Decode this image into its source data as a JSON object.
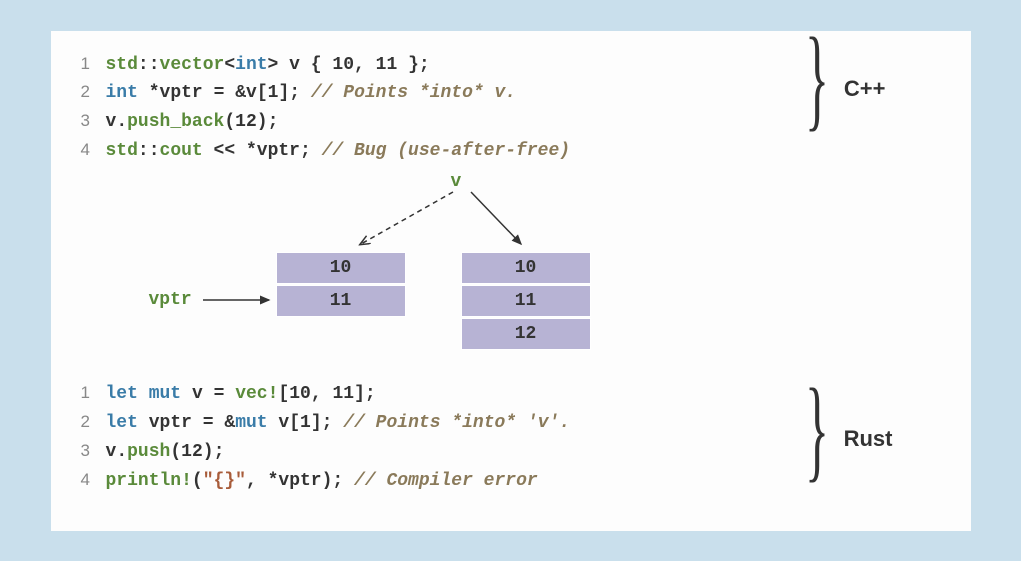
{
  "cpp": {
    "lines": [
      {
        "num": "1",
        "tokens": [
          {
            "cls": "tk-ns",
            "t": "std"
          },
          {
            "cls": "tk-op",
            "t": "::"
          },
          {
            "cls": "tk-ns",
            "t": "vector"
          },
          {
            "cls": "tk-op",
            "t": "<"
          },
          {
            "cls": "tk-type",
            "t": "int"
          },
          {
            "cls": "tk-op",
            "t": ">"
          },
          {
            "cls": "",
            "t": " "
          },
          {
            "cls": "tk-var",
            "t": "v"
          },
          {
            "cls": "",
            "t": " "
          },
          {
            "cls": "tk-op",
            "t": "{"
          },
          {
            "cls": "",
            "t": " "
          },
          {
            "cls": "tk-num",
            "t": "10"
          },
          {
            "cls": "tk-op",
            "t": ","
          },
          {
            "cls": "",
            "t": " "
          },
          {
            "cls": "tk-num",
            "t": "11"
          },
          {
            "cls": "",
            "t": " "
          },
          {
            "cls": "tk-op",
            "t": "}"
          },
          {
            "cls": "tk-op",
            "t": ";"
          }
        ]
      },
      {
        "num": "2",
        "tokens": [
          {
            "cls": "tk-type",
            "t": "int"
          },
          {
            "cls": "",
            "t": " "
          },
          {
            "cls": "tk-op",
            "t": "*"
          },
          {
            "cls": "tk-var",
            "t": "vptr"
          },
          {
            "cls": "",
            "t": " "
          },
          {
            "cls": "tk-op",
            "t": "="
          },
          {
            "cls": "",
            "t": " "
          },
          {
            "cls": "tk-op",
            "t": "&"
          },
          {
            "cls": "tk-var",
            "t": "v"
          },
          {
            "cls": "tk-op",
            "t": "["
          },
          {
            "cls": "tk-num",
            "t": "1"
          },
          {
            "cls": "tk-op",
            "t": "]"
          },
          {
            "cls": "tk-op",
            "t": ";"
          },
          {
            "cls": "",
            "t": " "
          },
          {
            "cls": "tk-comment",
            "t": "// Points *into* v."
          }
        ]
      },
      {
        "num": "3",
        "tokens": [
          {
            "cls": "tk-var",
            "t": "v"
          },
          {
            "cls": "tk-op",
            "t": "."
          },
          {
            "cls": "tk-fn",
            "t": "push_back"
          },
          {
            "cls": "tk-op",
            "t": "("
          },
          {
            "cls": "tk-num",
            "t": "12"
          },
          {
            "cls": "tk-op",
            "t": ")"
          },
          {
            "cls": "tk-op",
            "t": ";"
          }
        ]
      },
      {
        "num": "4",
        "tokens": [
          {
            "cls": "tk-ns",
            "t": "std"
          },
          {
            "cls": "tk-op",
            "t": "::"
          },
          {
            "cls": "tk-ns",
            "t": "cout"
          },
          {
            "cls": "",
            "t": " "
          },
          {
            "cls": "tk-op",
            "t": "<<"
          },
          {
            "cls": "",
            "t": " "
          },
          {
            "cls": "tk-op",
            "t": "*"
          },
          {
            "cls": "tk-var",
            "t": "vptr"
          },
          {
            "cls": "tk-op",
            "t": ";"
          },
          {
            "cls": "",
            "t": " "
          },
          {
            "cls": "tk-comment",
            "t": "// Bug (use-after-free)"
          }
        ]
      }
    ],
    "label": "C++"
  },
  "rust": {
    "lines": [
      {
        "num": "1",
        "tokens": [
          {
            "cls": "tk-kw",
            "t": "let mut"
          },
          {
            "cls": "",
            "t": " "
          },
          {
            "cls": "tk-var",
            "t": "v"
          },
          {
            "cls": "",
            "t": " "
          },
          {
            "cls": "tk-op",
            "t": "="
          },
          {
            "cls": "",
            "t": " "
          },
          {
            "cls": "tk-macro",
            "t": "vec!"
          },
          {
            "cls": "tk-op",
            "t": "["
          },
          {
            "cls": "tk-num",
            "t": "10"
          },
          {
            "cls": "tk-op",
            "t": ","
          },
          {
            "cls": "",
            "t": " "
          },
          {
            "cls": "tk-num",
            "t": "11"
          },
          {
            "cls": "tk-op",
            "t": "]"
          },
          {
            "cls": "tk-op",
            "t": ";"
          }
        ]
      },
      {
        "num": "2",
        "tokens": [
          {
            "cls": "tk-kw",
            "t": "let"
          },
          {
            "cls": "",
            "t": " "
          },
          {
            "cls": "tk-var",
            "t": "vptr"
          },
          {
            "cls": "",
            "t": " "
          },
          {
            "cls": "tk-op",
            "t": "="
          },
          {
            "cls": "",
            "t": " "
          },
          {
            "cls": "tk-op",
            "t": "&"
          },
          {
            "cls": "tk-kw",
            "t": "mut"
          },
          {
            "cls": "",
            "t": " "
          },
          {
            "cls": "tk-var",
            "t": "v"
          },
          {
            "cls": "tk-op",
            "t": "["
          },
          {
            "cls": "tk-num",
            "t": "1"
          },
          {
            "cls": "tk-op",
            "t": "]"
          },
          {
            "cls": "tk-op",
            "t": ";"
          },
          {
            "cls": "",
            "t": " "
          },
          {
            "cls": "tk-comment",
            "t": "// Points *into* 'v'."
          }
        ]
      },
      {
        "num": "3",
        "tokens": [
          {
            "cls": "tk-var",
            "t": "v"
          },
          {
            "cls": "tk-op",
            "t": "."
          },
          {
            "cls": "tk-fn",
            "t": "push"
          },
          {
            "cls": "tk-op",
            "t": "("
          },
          {
            "cls": "tk-num",
            "t": "12"
          },
          {
            "cls": "tk-op",
            "t": ")"
          },
          {
            "cls": "tk-op",
            "t": ";"
          }
        ]
      },
      {
        "num": "4",
        "tokens": [
          {
            "cls": "tk-macro",
            "t": "println!"
          },
          {
            "cls": "tk-op",
            "t": "("
          },
          {
            "cls": "tk-str",
            "t": "\"{}\""
          },
          {
            "cls": "tk-op",
            "t": ","
          },
          {
            "cls": "",
            "t": " "
          },
          {
            "cls": "tk-op",
            "t": "*"
          },
          {
            "cls": "tk-var",
            "t": "vptr"
          },
          {
            "cls": "tk-op",
            "t": ")"
          },
          {
            "cls": "tk-op",
            "t": ";"
          },
          {
            "cls": "",
            "t": " "
          },
          {
            "cls": "tk-comment",
            "t": "// Compiler error"
          }
        ]
      }
    ],
    "label": "Rust"
  },
  "diagram": {
    "v_label": "v",
    "vptr_label": "vptr",
    "left_cells": [
      "10",
      "11"
    ],
    "right_cells": [
      "10",
      "11",
      "12"
    ]
  }
}
